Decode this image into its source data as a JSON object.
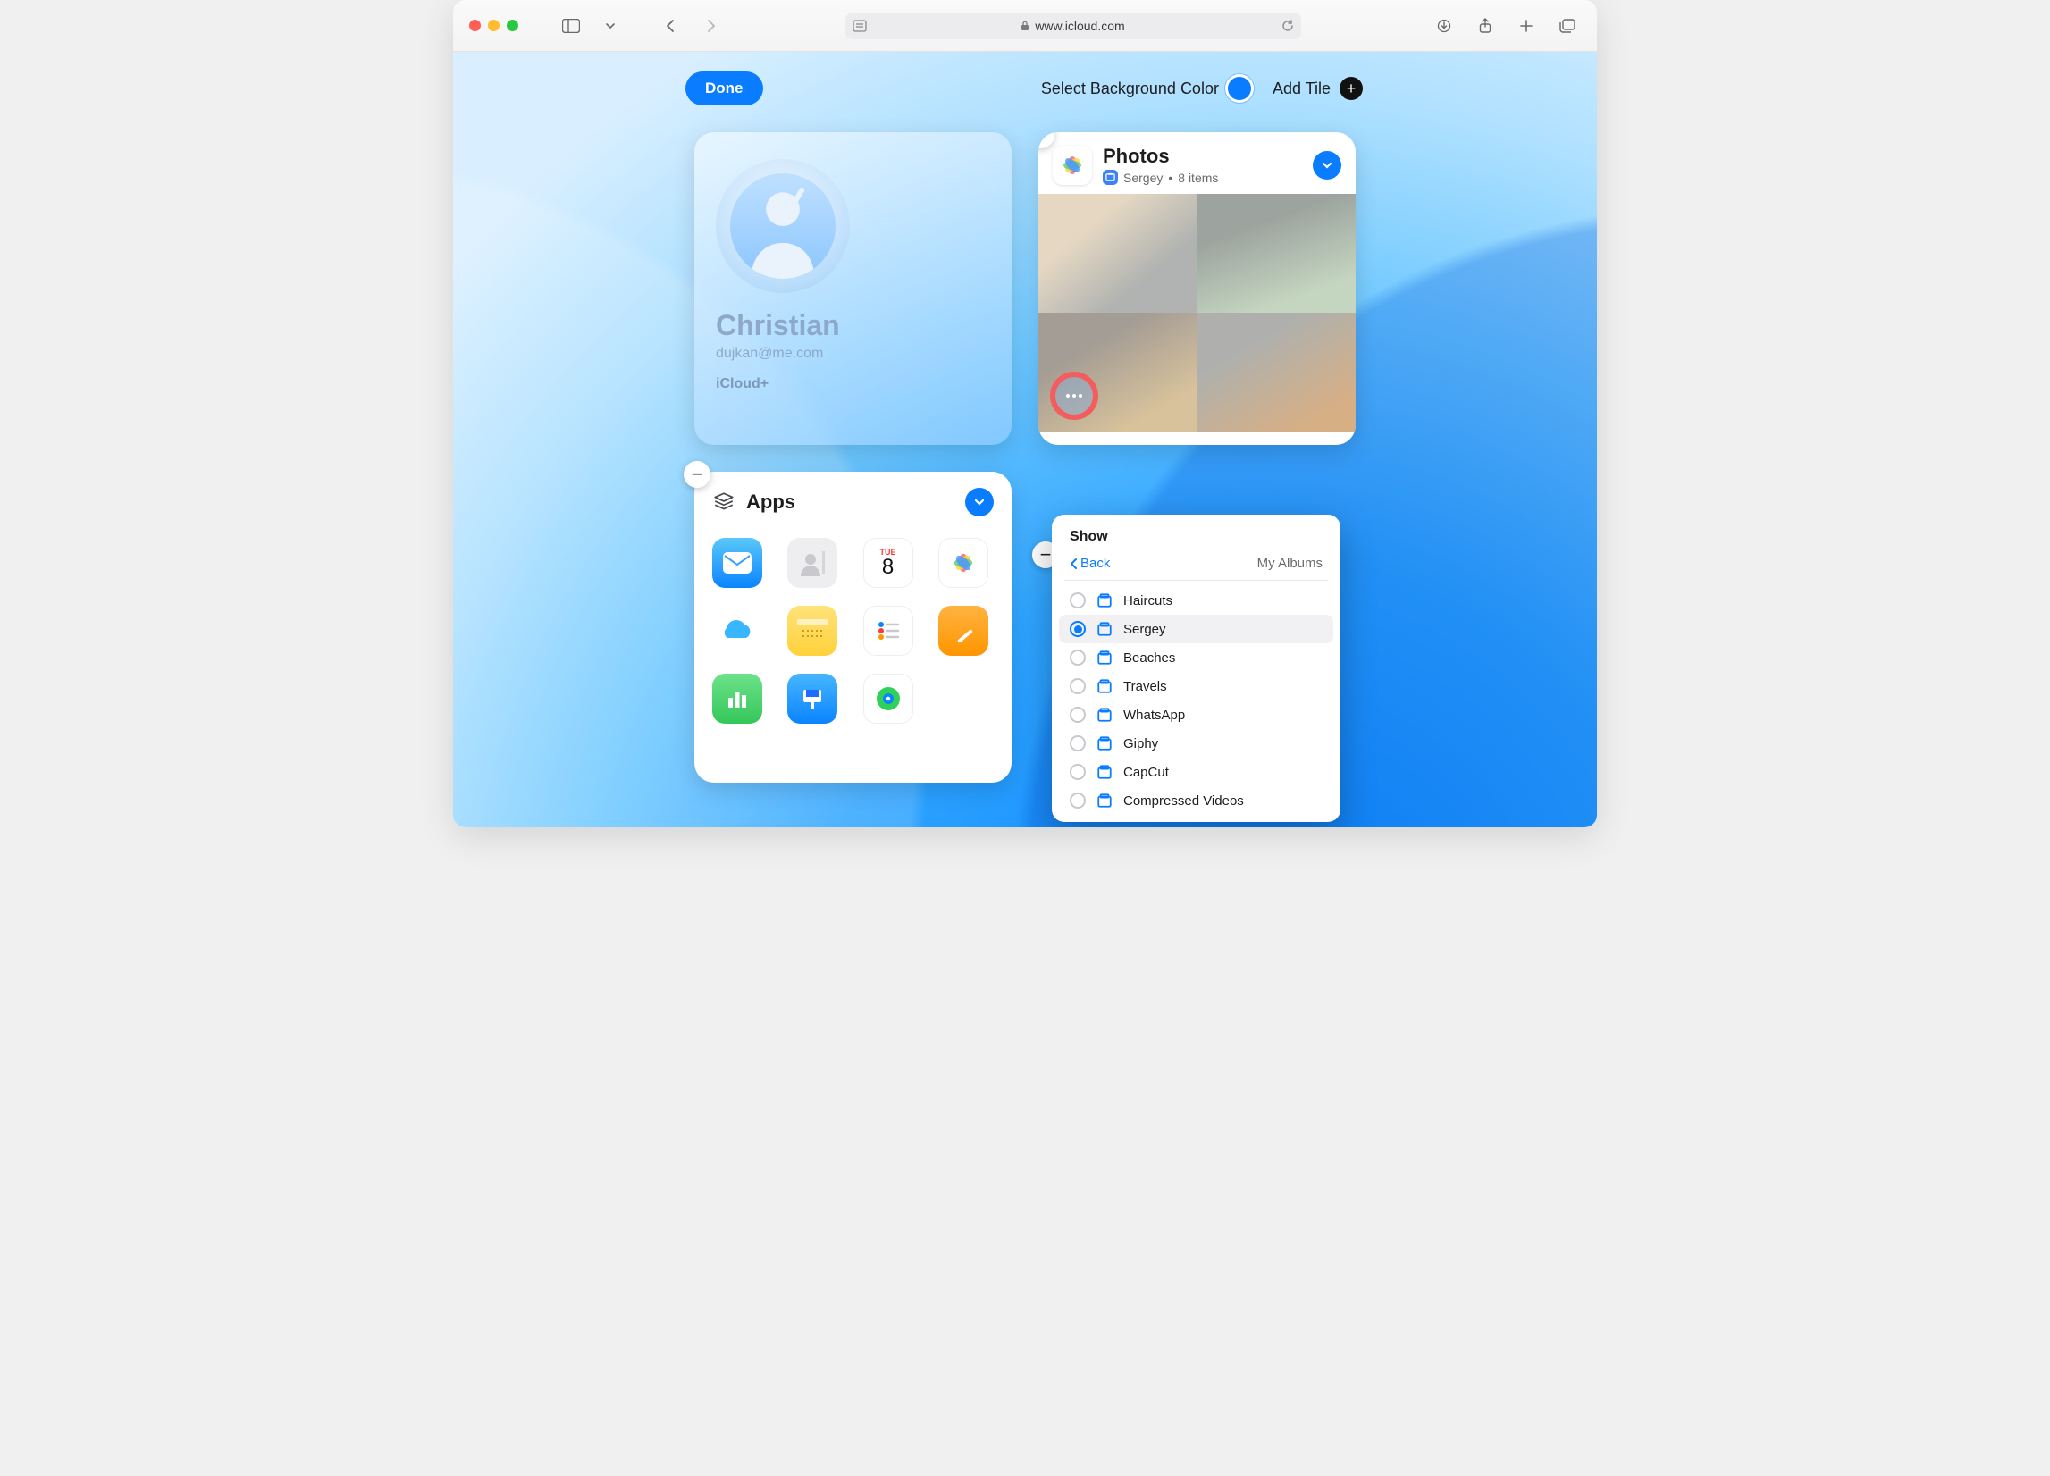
{
  "browser": {
    "url_display": "www.icloud.com"
  },
  "header": {
    "done": "Done",
    "bg_label": "Select Background Color",
    "add_tile": "Add Tile"
  },
  "profile": {
    "name": "Christian",
    "email": "dujkan@me.com",
    "plan": "iCloud+"
  },
  "photos_tile": {
    "title": "Photos",
    "album": "Sergey",
    "count_label": "8 items"
  },
  "apps_tile": {
    "title": "Apps",
    "calendar": {
      "dow": "TUE",
      "day": "8"
    }
  },
  "popover": {
    "title": "Show",
    "back": "Back",
    "breadcrumb": "My Albums",
    "selected_index": 1,
    "items": [
      "Haircuts",
      "Sergey",
      "Beaches",
      "Travels",
      "WhatsApp",
      "Giphy",
      "CapCut",
      "Compressed Videos"
    ]
  }
}
